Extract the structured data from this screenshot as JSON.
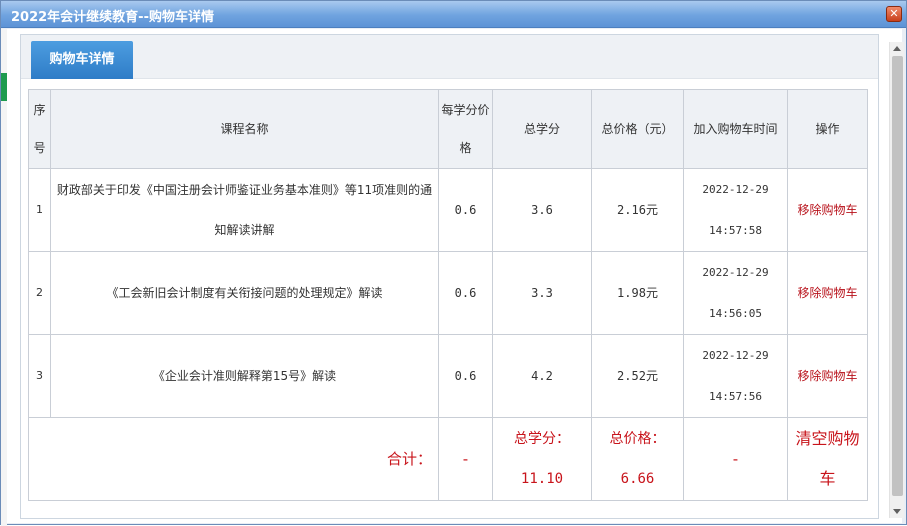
{
  "window": {
    "title": "2022年会计继续教育--购物车详情",
    "close_label": "✕"
  },
  "tab": {
    "label": "购物车详情"
  },
  "table": {
    "headers": {
      "index": "序号",
      "course": "课程名称",
      "unit_price": "每学分价格",
      "total_credits": "总学分",
      "total_price": "总价格（元）",
      "added_time": "加入购物车时间",
      "action": "操作"
    },
    "rows": [
      {
        "index": "1",
        "course": "财政部关于印发《中国注册会计师鉴证业务基本准则》等11项准则的通知解读讲解",
        "unit_price": "0.6",
        "credits": "3.6",
        "price": "2.16元",
        "date": "2022-12-29",
        "time": "14:57:58",
        "action": "移除购物车"
      },
      {
        "index": "2",
        "course": "《工会新旧会计制度有关衔接问题的处理规定》解读",
        "unit_price": "0.6",
        "credits": "3.3",
        "price": "1.98元",
        "date": "2022-12-29",
        "time": "14:56:05",
        "action": "移除购物车"
      },
      {
        "index": "3",
        "course": "《企业会计准则解释第15号》解读",
        "unit_price": "0.6",
        "credits": "4.2",
        "price": "2.52元",
        "date": "2022-12-29",
        "time": "14:57:56",
        "action": "移除购物车"
      }
    ],
    "total": {
      "label": "合计：",
      "unit_price": "-",
      "credits_label": "总学分：",
      "credits_value": "11.10",
      "price_label": "总价格：",
      "price_value": "6.66",
      "time": "-",
      "clear_label": "清空购物车"
    }
  },
  "colors": {
    "accent": "#2e7cc7",
    "danger": "#c8141b",
    "titlebar": "#6fa3df"
  }
}
